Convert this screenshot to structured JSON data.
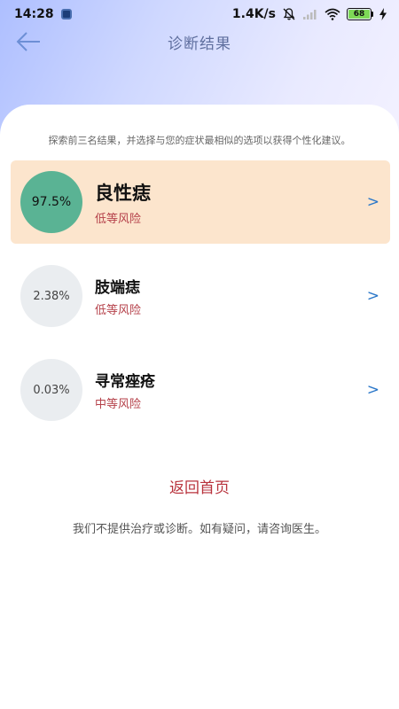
{
  "status_bar": {
    "time": "14:28",
    "net_speed": "1.4K/s",
    "battery": "68"
  },
  "header": {
    "title": "诊断结果"
  },
  "main": {
    "subtitle": "探索前三名结果，并选择与您的症状最相似的选项以获得个性化建议。",
    "results": [
      {
        "probability": "97.5%",
        "name": "良性痣",
        "risk": "低等风险",
        "chevron": ">"
      },
      {
        "probability": "2.38%",
        "name": "肢端痣",
        "risk": "低等风险",
        "chevron": ">"
      },
      {
        "probability": "0.03%",
        "name": "寻常痤疮",
        "risk": "中等风险",
        "chevron": ">"
      }
    ],
    "home_link": "返回首页",
    "disclaimer": "我们不提供治疗或诊断。如有疑问，请咨询医生。"
  },
  "colors": {
    "highlight_bg": "#fce5cd",
    "top_circle": "#5ab394",
    "risk_text": "#b5414a",
    "link_text": "#b8323c",
    "chevron": "#2a77c9"
  }
}
